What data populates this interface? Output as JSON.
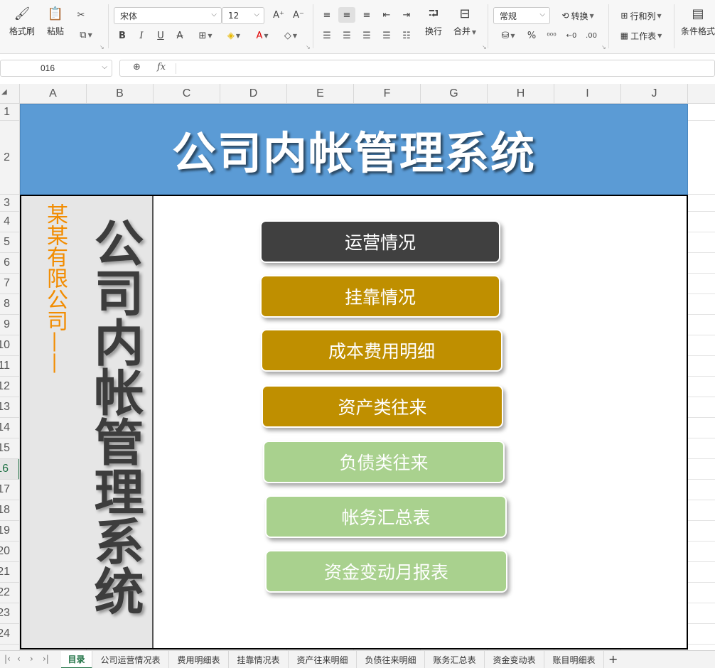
{
  "ribbon": {
    "format_painter": "格式刷",
    "paste": "粘贴",
    "font_name": "宋体",
    "font_size": "12",
    "wrap_text": "换行",
    "merge": "合并",
    "number_format": "常规",
    "convert": "转换",
    "rows_cols": "行和列",
    "worksheet": "工作表",
    "conditional_format": "条件格式"
  },
  "formula_bar": {
    "name_box": "016",
    "fx": "fx",
    "content": ""
  },
  "columns": [
    "A",
    "B",
    "C",
    "D",
    "E",
    "F",
    "G",
    "H",
    "I",
    "J"
  ],
  "rows": [
    "1",
    "2",
    "3",
    "4",
    "5",
    "6",
    "7",
    "8",
    "9",
    "10",
    "11",
    "12",
    "13",
    "14",
    "15",
    "16",
    "17",
    "18",
    "19",
    "20",
    "21",
    "22",
    "23",
    "24"
  ],
  "selected_row": "16",
  "sheet": {
    "banner_title": "公司内帐管理系统",
    "company": "某某有限公司——",
    "vertical_title": "公司内帐管理系统",
    "nav": [
      {
        "label": "运营情况",
        "style": "dark"
      },
      {
        "label": "挂靠情况",
        "style": "gold"
      },
      {
        "label": "成本费用明细",
        "style": "gold"
      },
      {
        "label": "资产类往来",
        "style": "gold"
      },
      {
        "label": "负债类往来",
        "style": "green"
      },
      {
        "label": "帐务汇总表",
        "style": "green"
      },
      {
        "label": "资金变动月报表",
        "style": "green"
      }
    ]
  },
  "tabs": [
    "目录",
    "公司运营情况表",
    "费用明细表",
    "挂靠情况表",
    "资产往来明细",
    "负债往来明细",
    "账务汇总表",
    "资金变动表",
    "账目明细表"
  ],
  "active_tab": "目录",
  "colors": {
    "banner": "#5b9bd5",
    "dark": "#404040",
    "gold": "#bf8f00",
    "green": "#a9d18e",
    "company": "#f28c00"
  }
}
